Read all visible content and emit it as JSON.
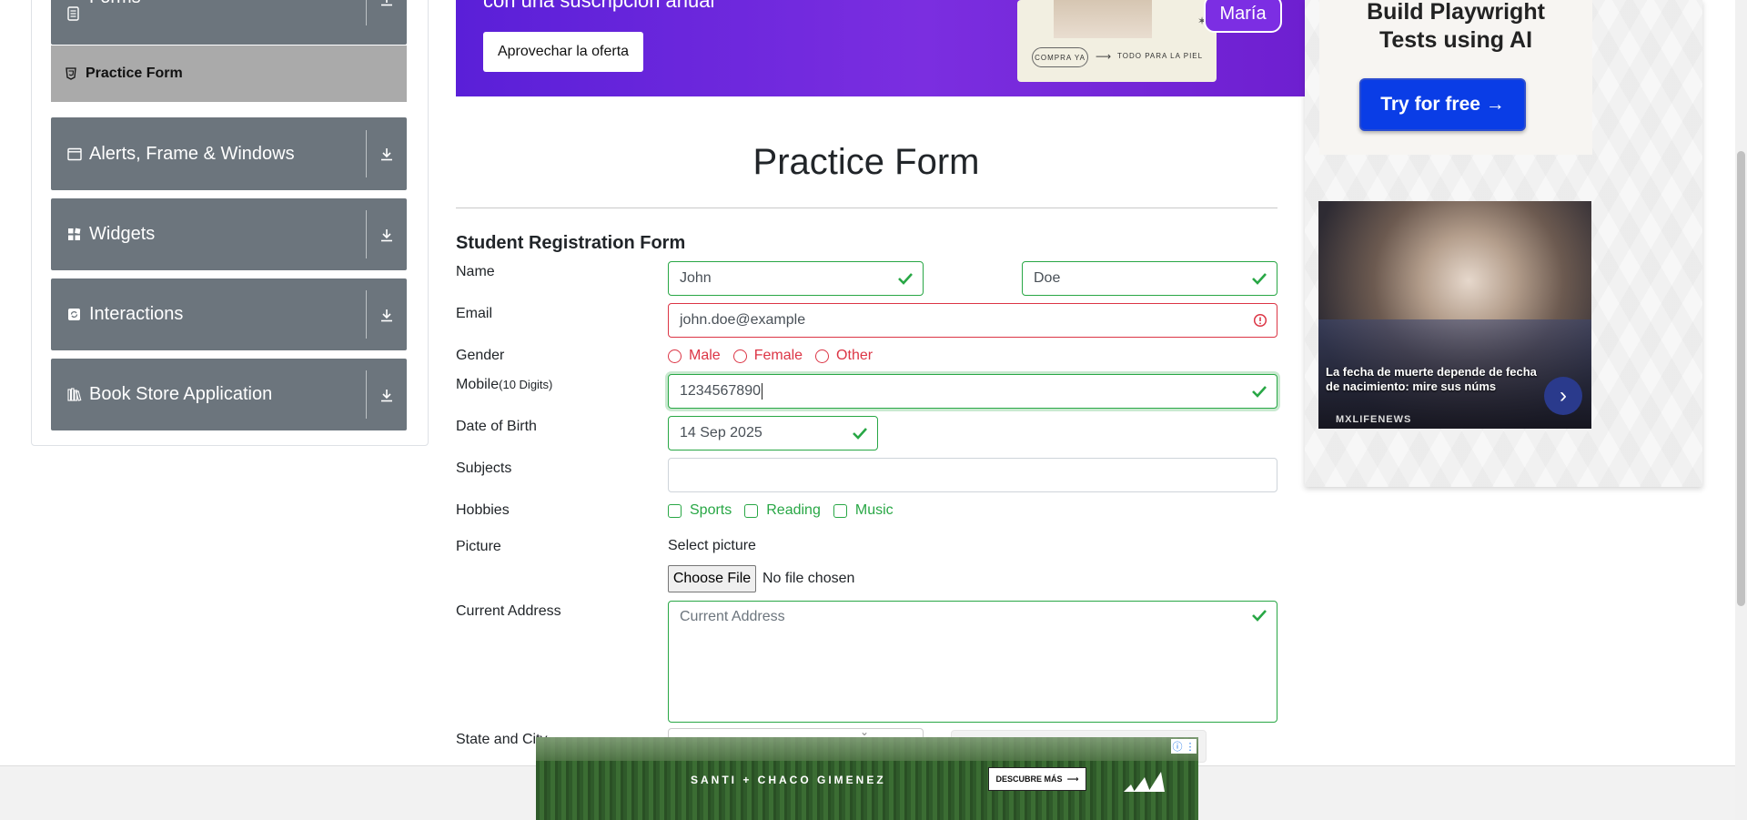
{
  "sidebar": {
    "groups": [
      {
        "label": "Forms",
        "icon": "forms-icon",
        "state": "expanded"
      },
      {
        "label": "Alerts, Frame & Windows",
        "icon": "window-icon",
        "state": "collapsed"
      },
      {
        "label": "Widgets",
        "icon": "widgets-icon",
        "state": "collapsed"
      },
      {
        "label": "Interactions",
        "icon": "interactions-icon",
        "state": "collapsed"
      },
      {
        "label": "Book Store Application",
        "icon": "books-icon",
        "state": "collapsed"
      }
    ],
    "active_item": {
      "label": "Practice Form",
      "icon": "html5-icon"
    }
  },
  "top_ad": {
    "headline": "con una suscripción anual",
    "cta": "Aprovechar la oferta",
    "compra": "COMPRA YA",
    "tagline": "TODO PARA LA PIEL",
    "name_badge": "María"
  },
  "right_ad": {
    "title_line1": "Build Playwright",
    "title_line2": "Tests using AI",
    "button": "Try for free →",
    "news_text": "La fecha de muerte depende de fecha de nacimiento: mire sus núms",
    "news_brand": "MXLIFENEWS"
  },
  "page": {
    "title": "Practice Form",
    "form_heading": "Student Registration Form"
  },
  "form": {
    "labels": {
      "name": "Name",
      "email": "Email",
      "gender": "Gender",
      "mobile": "Mobile",
      "mobile_hint": "(10 Digits)",
      "dob": "Date of Birth",
      "subjects": "Subjects",
      "hobbies": "Hobbies",
      "picture": "Picture",
      "address": "Current Address",
      "state_city": "State and City"
    },
    "first_name": "John",
    "last_name": "Doe",
    "email": "john.doe@example",
    "gender_options": [
      "Male",
      "Female",
      "Other"
    ],
    "mobile": "1234567890",
    "dob": "14 Sep 2025",
    "subjects": "",
    "hobby_options": [
      "Sports",
      "Reading",
      "Music"
    ],
    "picture_prompt": "Select picture",
    "file_button": "Choose File",
    "file_status": "No file chosen",
    "address_placeholder": "Current Address"
  },
  "bottom_ad": {
    "text": "SANTI + CHACO GIMENEZ",
    "button": "DESCUBRE MÁS",
    "arrow": "⟶"
  },
  "colors": {
    "sidebar_bg": "#6c757d",
    "active_item_bg": "#aaaaaa",
    "valid": "#28a745",
    "invalid": "#dc3545",
    "ad_purple": "#6e22dc",
    "cta_blue": "#0a3de6"
  }
}
